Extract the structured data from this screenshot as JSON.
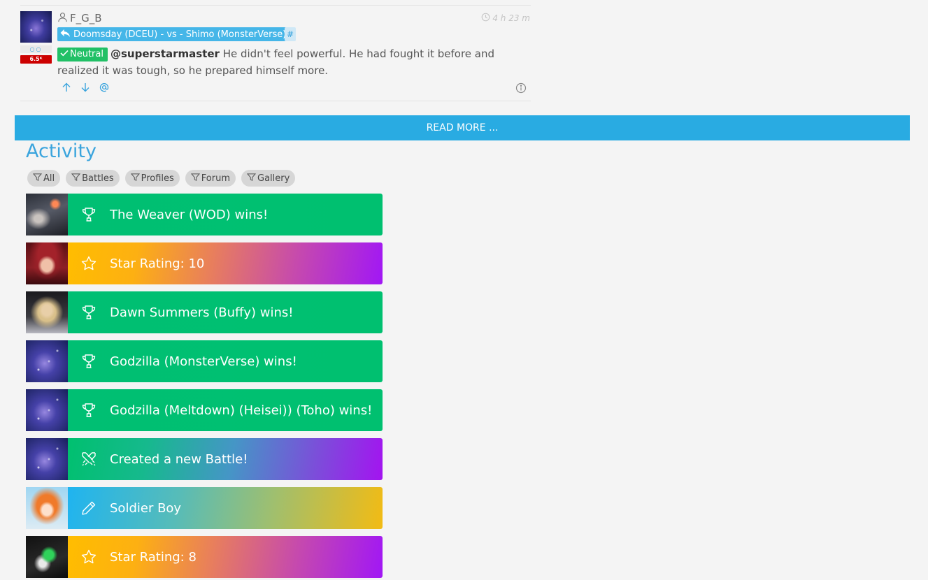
{
  "post": {
    "avatar_stats": "○○",
    "rank_badge": "6.5ᴷ",
    "username": "F_G_B",
    "time": "4 h 23 m",
    "battle_link": "Doomsday (DCEU) - vs - Shimo (MonsterVerse)",
    "hash": "#",
    "stance": "Neutral",
    "mention": "@superstarmaster",
    "text": " He didn't feel powerful. He had fought it before and realized it was tough, so he prepared himself more."
  },
  "read_more": "READ MORE ...",
  "activity": {
    "title": "Activity",
    "filters": [
      {
        "label": "All"
      },
      {
        "label": "Battles"
      },
      {
        "label": "Profiles"
      },
      {
        "label": "Forum"
      },
      {
        "label": "Gallery"
      }
    ],
    "items": [
      {
        "text": "The Weaver (WOD) wins!",
        "icon": "trophy-icon",
        "style": "g-green",
        "thumb": "t-weaver"
      },
      {
        "text": "Star Rating: 10",
        "icon": "star-icon",
        "style": "g-star",
        "thumb": "t-wanda"
      },
      {
        "text": "Dawn Summers (Buffy) wins!",
        "icon": "trophy-icon",
        "style": "g-green",
        "thumb": "t-dawn"
      },
      {
        "text": "Godzilla (MonsterVerse) wins!",
        "icon": "trophy-icon",
        "style": "g-green",
        "thumb": "t-space"
      },
      {
        "text": "Godzilla (Meltdown) (Heisei)) (Toho) wins!",
        "icon": "trophy-icon",
        "style": "g-green",
        "thumb": "t-space"
      },
      {
        "text": "Created a new Battle!",
        "icon": "crossed-swords-icon",
        "style": "g-create",
        "thumb": "t-space"
      },
      {
        "text": "Soldier Boy",
        "icon": "pencil-icon",
        "style": "g-edit",
        "thumb": "t-anime"
      },
      {
        "text": "Star Rating: 8",
        "icon": "star-icon",
        "style": "g-star",
        "thumb": "t-lantern"
      }
    ]
  },
  "colors": {
    "accent": "#29abe2",
    "green": "#00bf73",
    "neutral_badge": "#21c066",
    "rank_red": "#cc0000"
  }
}
